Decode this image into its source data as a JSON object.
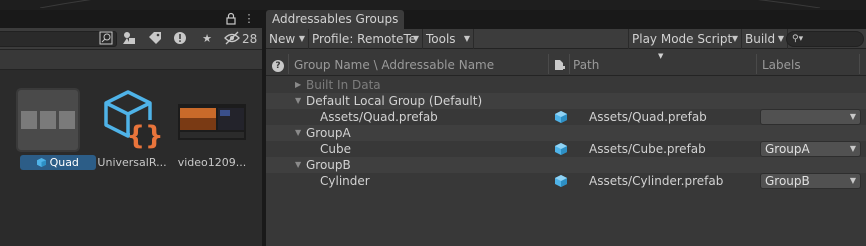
{
  "colors": {
    "selection": "#2c5d87",
    "accent_cube": "#4fb3e8",
    "script_brace": "#e8743b"
  },
  "project_panel": {
    "tabbar_icons": [
      "lock-icon",
      "menu-icon"
    ],
    "toolbar_icons": [
      "search-by-type-icon",
      "filter-by-label-icon",
      "tag-icon",
      "warning-icon",
      "star-icon",
      "hidden-packages-icon"
    ],
    "hidden_count": "28",
    "assets": [
      {
        "label": "Quad",
        "icon": "prefab-icon",
        "selected": true
      },
      {
        "label": "UniversalR...",
        "icon": "script-asset-icon",
        "selected": false
      },
      {
        "label": "video1209...",
        "icon": "video-thumbnail",
        "selected": false
      }
    ]
  },
  "addressables": {
    "tab_title": "Addressables Groups",
    "toolbar": {
      "new": "New",
      "profile": "Profile: RemoteTe",
      "tools": "Tools",
      "play_mode": "Play Mode Script",
      "build": "Build"
    },
    "columns": {
      "name": "Group Name \\ Addressable Name",
      "path": "Path",
      "labels": "Labels"
    },
    "rows": [
      {
        "type": "group",
        "name": "Built In Data",
        "expanded": false,
        "dim": true
      },
      {
        "type": "group",
        "name": "Default Local Group (Default)",
        "expanded": true
      },
      {
        "type": "entry",
        "name": "Assets/Quad.prefab",
        "path": "Assets/Quad.prefab",
        "label": ""
      },
      {
        "type": "group",
        "name": "GroupA",
        "expanded": true
      },
      {
        "type": "entry",
        "name": "Cube",
        "path": "Assets/Cube.prefab",
        "label": "GroupA"
      },
      {
        "type": "group",
        "name": "GroupB",
        "expanded": true
      },
      {
        "type": "entry",
        "name": "Cylinder",
        "path": "Assets/Cylinder.prefab",
        "label": "GroupB"
      }
    ]
  }
}
